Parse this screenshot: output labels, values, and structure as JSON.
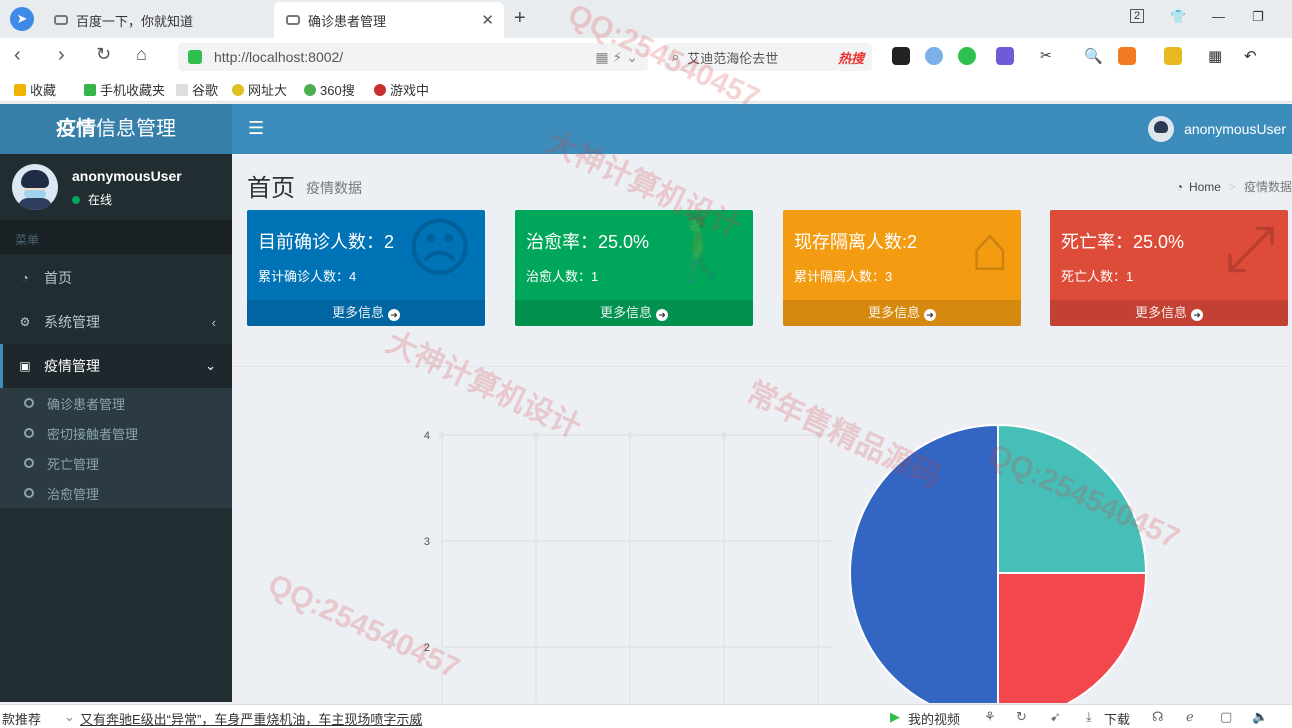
{
  "browser": {
    "tabs": [
      {
        "label": "百度一下，你就知道"
      },
      {
        "label": "确诊患者管理",
        "active": true
      }
    ],
    "url": "http://localhost:8002/",
    "search_hint": "艾迪范海伦去世",
    "hot_label": "热搜",
    "tab_count": "2",
    "bookmarks": [
      "收藏",
      "手机收藏夹",
      "谷歌",
      "网址大",
      "360搜",
      "游戏中"
    ]
  },
  "app": {
    "logo_bold": "疫情",
    "logo_rest": "信息管理",
    "top_user": "anonymousUser"
  },
  "sidebar": {
    "username": "anonymousUser",
    "status": "在线",
    "menu_header": "菜单",
    "items": [
      {
        "label": "首页",
        "icon": "dashboard-icon"
      },
      {
        "label": "系统管理",
        "icon": "cogs-icon"
      },
      {
        "label": "疫情管理",
        "icon": "cube-icon",
        "expanded": true
      }
    ],
    "subitems": [
      {
        "label": "确诊患者管理"
      },
      {
        "label": "密切接触者管理"
      },
      {
        "label": "死亡管理"
      },
      {
        "label": "治愈管理"
      }
    ]
  },
  "content": {
    "title": "首页",
    "subtitle": "疫情数据",
    "breadcrumb_home": "Home",
    "breadcrumb_current": "疫情数据"
  },
  "boxes": [
    {
      "big": "目前确诊人数：2",
      "small": "累计确诊人数：4",
      "footer": "更多信息",
      "color": "#0073b7",
      "icon": "frown-icon"
    },
    {
      "big": "治愈率：25.0%",
      "small": "治愈人数：1",
      "footer": "更多信息",
      "color": "#00a65a",
      "icon": "walking-icon"
    },
    {
      "big": "现存隔离人数:2",
      "small": "累计隔离人数：3",
      "footer": "更多信息",
      "color": "#f39c12",
      "icon": "home-icon"
    },
    {
      "big": "死亡率：25.0%",
      "small": "死亡人数：1",
      "footer": "更多信息",
      "color": "#dd4b39",
      "icon": "expand-icon"
    }
  ],
  "chart_data": [
    {
      "type": "line",
      "y_ticks": [
        "4",
        "3",
        "2"
      ],
      "ylim": [
        2,
        4
      ],
      "grid": true
    },
    {
      "type": "pie",
      "values": [
        2,
        1,
        1
      ],
      "colors": [
        "#3366c2",
        "#f2474c",
        "#46bfb9"
      ]
    }
  ],
  "statusbar": {
    "left": "款推荐",
    "news": "又有奔驰E级出“异常”，车身严重烧机油，车主现场喷字示威",
    "video": "我的视频",
    "download": "下载"
  },
  "watermarks": [
    "QQ:254540457",
    "大神计算机设计",
    "常年售精品源码"
  ]
}
